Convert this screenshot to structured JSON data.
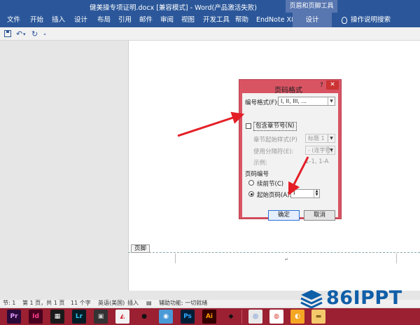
{
  "window": {
    "title": "健美操专项证明.docx [兼容模式] - Word(产品激活失败)",
    "context_tab_group": "页眉和页脚工具"
  },
  "ribbon": {
    "tabs": [
      "文件",
      "开始",
      "插入",
      "设计",
      "布局",
      "引用",
      "邮件",
      "审阅",
      "视图",
      "开发工具",
      "帮助",
      "EndNote X8",
      "设计"
    ],
    "tell_me": "操作说明搜索"
  },
  "quick_access": {
    "save_icon": "save-icon",
    "undo_icon": "undo-icon",
    "redo_icon": "redo-icon",
    "customize_icon": "customize-icon"
  },
  "document": {
    "footer_tag": "页脚"
  },
  "dialog": {
    "title": "页码格式",
    "help": "?",
    "number_format_label": "编号格式(F):",
    "number_format_value": "I, II, III, ...",
    "include_chapter_label": "包含章节号(N)",
    "chapter_style_label": "章节起始样式(P)",
    "chapter_style_value": "标题 1",
    "separator_label": "使用分隔符(E):",
    "separator_value": "- (连字符)",
    "example_label": "示例:",
    "example_value": "1-1, 1-A",
    "page_numbering_label": "页码编号",
    "continue_label": "续前节(C)",
    "start_at_label": "起始页码(A):",
    "start_at_value": "I",
    "start_at_selected": true,
    "ok_label": "确定",
    "cancel_label": "取消"
  },
  "statusbar": {
    "section": "节: 1",
    "page": "第 1 页，共 1 页",
    "words": "11 个字",
    "language": "英语(美国)",
    "insert_mode": "插入",
    "accessibility": "辅助功能: 一切就绪"
  },
  "taskbar": {
    "apps": [
      {
        "name": "premiere-icon",
        "label": "Pr",
        "bg": "#2a0a3b",
        "fg": "#e39bff"
      },
      {
        "name": "indesign-icon",
        "label": "Id",
        "bg": "#49021f",
        "fg": "#ff3f8f"
      },
      {
        "name": "film-icon",
        "label": "▦",
        "bg": "#1a1a1a",
        "fg": "#ffffff"
      },
      {
        "name": "lightroom-icon",
        "label": "Lr",
        "bg": "#001d26",
        "fg": "#31c5f0"
      },
      {
        "name": "app-icon",
        "label": "▣",
        "bg": "#333333",
        "fg": "#cccccc"
      },
      {
        "name": "pdf-icon",
        "label": "◭",
        "bg": "#f2f2f2",
        "fg": "#d01f2f"
      },
      {
        "name": "qq-icon",
        "label": "●",
        "bg": "#9a2032",
        "fg": "#111111"
      },
      {
        "name": "chat-icon",
        "label": "◉",
        "bg": "#4a9ad8",
        "fg": "#ffffff"
      },
      {
        "name": "photoshop-icon",
        "label": "Ps",
        "bg": "#001e36",
        "fg": "#31a8ff"
      },
      {
        "name": "illustrator-icon",
        "label": "Ai",
        "bg": "#330000",
        "fg": "#ff9a00"
      },
      {
        "name": "cube-icon",
        "label": "◆",
        "bg": "#9a2032",
        "fg": "#111111"
      },
      {
        "name": "browser-icon",
        "label": "◎",
        "bg": "#e8e8e8",
        "fg": "#3a6fd0"
      },
      {
        "name": "chrome-icon",
        "label": "◍",
        "bg": "#ffffff",
        "fg": "#db4437"
      },
      {
        "name": "fox-icon",
        "label": "◐",
        "bg": "#f5a623",
        "fg": "#ffffff"
      },
      {
        "name": "folder-icon",
        "label": "▬",
        "bg": "#f3c96b",
        "fg": "#8a6420"
      }
    ]
  },
  "watermark": {
    "text": "86IPPT"
  },
  "colors": {
    "ribbon": "#2b579a",
    "dialog_frame": "#d95463",
    "taskbar": "#9a2032",
    "arrow": "#e41e26",
    "watermark": "#0f5ea8"
  }
}
